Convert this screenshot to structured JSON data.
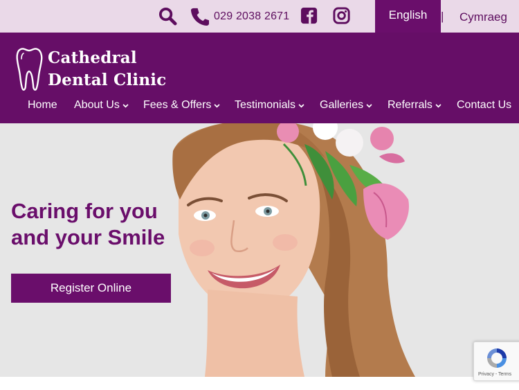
{
  "topbar": {
    "icons": [
      "search-icon",
      "phone-icon",
      "facebook-icon",
      "instagram-icon"
    ],
    "phone": "029 2038 2671",
    "languages": {
      "english": "English",
      "separator": "|",
      "welsh": "Cymraeg"
    }
  },
  "brand": {
    "line1": "Cathedral",
    "line2": "Dental Clinic",
    "logo_icon": "tooth-icon"
  },
  "nav": {
    "items": [
      {
        "label": "Home",
        "has_dropdown": false
      },
      {
        "label": "About Us",
        "has_dropdown": true
      },
      {
        "label": "Fees & Offers",
        "has_dropdown": true
      },
      {
        "label": "Testimonials",
        "has_dropdown": true
      },
      {
        "label": "Galleries",
        "has_dropdown": true
      },
      {
        "label": "Referrals",
        "has_dropdown": true
      },
      {
        "label": "Contact Us",
        "has_dropdown": false
      }
    ]
  },
  "hero": {
    "title_line1": "Caring for you",
    "title_line2": "and your Smile",
    "cta": "Register Online"
  },
  "recaptcha": {
    "links": "Privacy - Terms"
  },
  "colors": {
    "brand_purple": "#660e67",
    "topbar_bg": "#ead9e8",
    "hero_bg": "#e6e6e6"
  }
}
